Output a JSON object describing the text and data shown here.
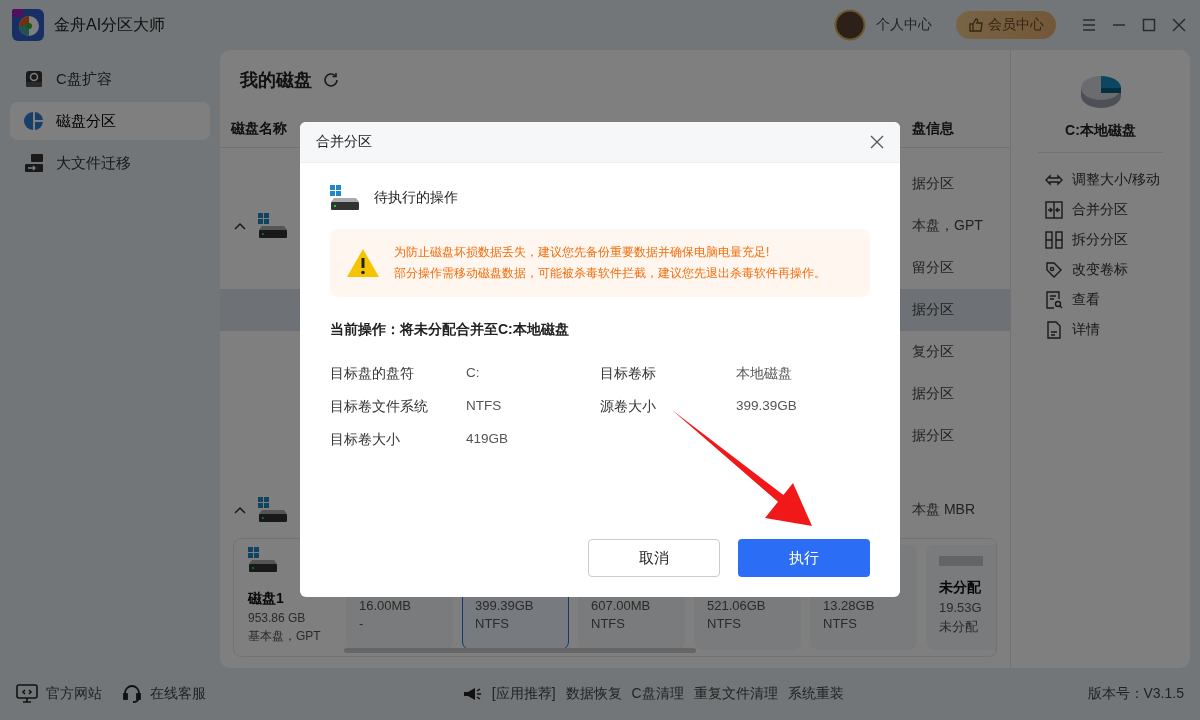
{
  "window": {
    "title": "金舟AI分区大师"
  },
  "account": {
    "user_label": "个人中心",
    "vip_button": "会员中心"
  },
  "sidebar": {
    "items": [
      {
        "label": "C盘扩容",
        "selected": false
      },
      {
        "label": "磁盘分区",
        "selected": true
      },
      {
        "label": "大文件迁移",
        "selected": false
      }
    ]
  },
  "disks": {
    "title": "我的磁盘",
    "columns": [
      "磁盘名称",
      "盘信息"
    ],
    "rows": [
      {
        "kind": "partition",
        "info": "据分区",
        "selected": false
      },
      {
        "kind": "disk",
        "info": "本盘，GPT",
        "expanded": true,
        "selected": false
      },
      {
        "kind": "partition",
        "info": "留分区",
        "selected": false
      },
      {
        "kind": "partition",
        "info": "据分区",
        "selected": true
      },
      {
        "kind": "partition",
        "info": "复分区",
        "selected": false
      },
      {
        "kind": "partition",
        "info": "据分区",
        "selected": false
      },
      {
        "kind": "partition",
        "info": "据分区",
        "selected": false
      },
      {
        "kind": "disk",
        "info": "本盘 MBR",
        "expanded": true,
        "selected": false
      }
    ]
  },
  "disk_map": {
    "disk": {
      "name": "磁盘1",
      "size": "953.86 GB",
      "type": "基本盘，GPT"
    },
    "partitions": [
      {
        "kind": "partition",
        "size": "16.00MB",
        "fs": "-",
        "selected": false
      },
      {
        "kind": "partition",
        "size": "399.39GB",
        "fs": "NTFS",
        "selected": true
      },
      {
        "kind": "partition",
        "size": "607.00MB",
        "fs": "NTFS",
        "selected": false
      },
      {
        "kind": "partition",
        "size": "521.06GB",
        "fs": "NTFS",
        "selected": false
      },
      {
        "kind": "partition",
        "size": "13.28GB",
        "fs": "NTFS",
        "selected": false
      },
      {
        "kind": "unallocated",
        "title": "未分配",
        "size": "19.53G",
        "fs": "未分配",
        "selected": false
      }
    ]
  },
  "details": {
    "title": "C:本地磁盘",
    "actions": [
      {
        "label": "调整大小/移动"
      },
      {
        "label": "合并分区"
      },
      {
        "label": "拆分分区"
      },
      {
        "label": "改变卷标"
      },
      {
        "label": "查看"
      },
      {
        "label": "详情"
      }
    ]
  },
  "footer": {
    "links": [
      {
        "label": "官方网站"
      },
      {
        "label": "在线客服"
      }
    ],
    "promo_label": "[应用推荐]",
    "promos": [
      "数据恢复",
      "C盘清理",
      "重复文件清理",
      "系统重装"
    ],
    "version": "版本号：V3.1.5"
  },
  "dialog": {
    "title": "合并分区",
    "section": "待执行的操作",
    "warnings": [
      "为防止磁盘坏损数据丢失，建议您先备份重要数据并确保电脑电量充足!",
      "部分操作需移动磁盘数据，可能被杀毒软件拦截，建议您先退出杀毒软件再操作。"
    ],
    "current": "当前操作：将未分配合并至C:本地磁盘",
    "fields": [
      {
        "label": "目标盘的盘符",
        "value": "C:"
      },
      {
        "label": "目标卷标",
        "value": "本地磁盘"
      },
      {
        "label": "目标卷文件系统",
        "value": "NTFS"
      },
      {
        "label": "源卷大小",
        "value": "399.39GB"
      },
      {
        "label": "目标卷大小",
        "value": "419GB"
      }
    ],
    "buttons": [
      {
        "label": "取消",
        "kind": "secondary"
      },
      {
        "label": "执行",
        "kind": "primary"
      }
    ]
  }
}
